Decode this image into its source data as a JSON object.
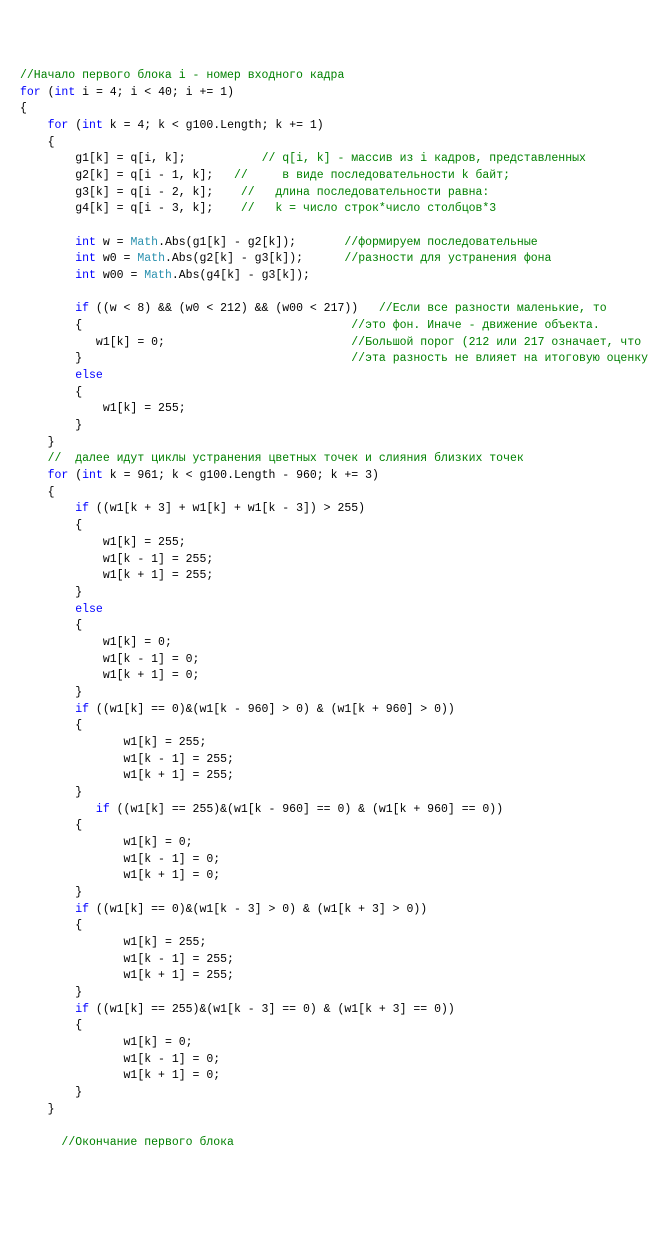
{
  "code": {
    "cmt_start": "//Начало первого блока i - номер входного кадра",
    "kw_for1": "for",
    "kw_int1": "int",
    "for1_rest": " i = 4; i < 40; i += 1)",
    "brace_o": "{",
    "brace_c": "}",
    "kw_for2": "for",
    "kw_int2": "int",
    "for2_rest": " k = 4; k < g100.Length; k += 1)",
    "g1": "g1[k] = q[i, k];",
    "g1_cmt": "// q[i, k] - массив из i кадров, представленных",
    "g2": "g2[k] = q[i - 1, k];",
    "g2_cmt": "//     в виде последовательности k байт;",
    "g3": "g3[k] = q[i - 2, k];",
    "g3_cmt": "//   длина последовательности равна:",
    "g4": "g4[k] = q[i - 3, k];",
    "g4_cmt": "//   k = число строк*число столбцов*3",
    "kw_int_w": "int",
    "w_decl": " w = ",
    "math": "Math",
    "w_abs": ".Abs(g1[k] - g2[k]);",
    "w_cmt": "//формируем последовательные",
    "kw_int_w0": "int",
    "w0_decl": " w0 = ",
    "w0_abs": ".Abs(g2[k] - g3[k]);",
    "w0_cmt": "//разности для устранения фона",
    "kw_int_w00": "int",
    "w00_decl": " w00 = ",
    "w00_abs": ".Abs(g4[k] - g3[k]);",
    "kw_if1": "if",
    "if1_cond": " ((w < 8) && (w0 < 212) && (w00 < 217))",
    "if1_cmt1": "//Если все разности маленькие, то",
    "if1_cmt2": "//это фон. Иначе - движение объекта.",
    "w1_0": "w1[k] = 0;",
    "if1_cmt3": "//Большой порог (212 или 217 означает, что",
    "if1_cmt4": "//эта разность не влияет на итоговую оценку",
    "kw_else": "else",
    "w1_255": "w1[k] = 255;",
    "cmt_mid": "//  далее идут циклы устранения цветных точек и слияния близких точек",
    "kw_for3": "for",
    "kw_int3": "int",
    "for3_rest": " k = 961; k < g100.Length - 960; k += 3)",
    "kw_if2": "if",
    "if2_cond": " ((w1[k + 3] + w1[k] + w1[k - 3]) > 255)",
    "blk2a1": "w1[k] = 255;",
    "blk2a2": "w1[k - 1] = 255;",
    "blk2a3": "w1[k + 1] = 255;",
    "blk2b1": "w1[k] = 0;",
    "blk2b2": "w1[k - 1] = 0;",
    "blk2b3": "w1[k + 1] = 0;",
    "kw_if3": "if",
    "if3_cond": " ((w1[k] == 0)&(w1[k - 960] > 0) & (w1[k + 960] > 0))",
    "kw_if4": "if",
    "if4_cond": " ((w1[k] == 255)&(w1[k - 960] == 0) & (w1[k + 960] == 0))",
    "kw_if5": "if",
    "if5_cond": " ((w1[k] == 0)&(w1[k - 3] > 0) & (w1[k + 3] > 0))",
    "kw_if6": "if",
    "if6_cond": " ((w1[k] == 255)&(w1[k - 3] == 0) & (w1[k + 3] == 0))",
    "cmt_end": "//Окончание первого блока"
  }
}
